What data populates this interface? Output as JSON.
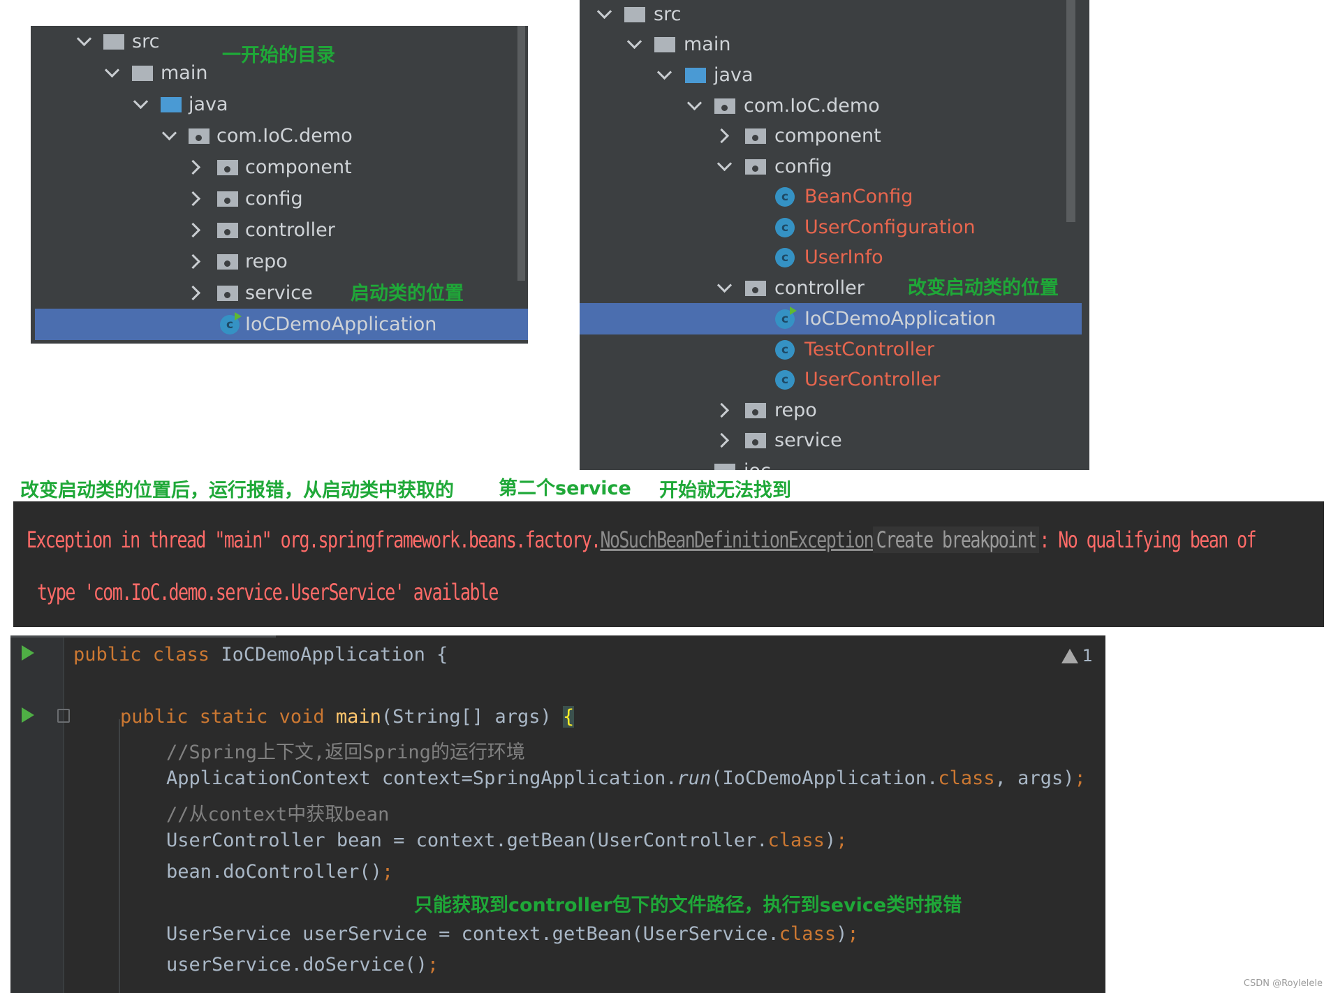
{
  "left_tree": {
    "items": [
      {
        "label": "src",
        "type": "folder"
      },
      {
        "label": "main",
        "type": "folder"
      },
      {
        "label": "java",
        "type": "source-folder"
      },
      {
        "label": "com.IoC.demo",
        "type": "package"
      },
      {
        "label": "component",
        "type": "package"
      },
      {
        "label": "config",
        "type": "package"
      },
      {
        "label": "controller",
        "type": "package"
      },
      {
        "label": "repo",
        "type": "package"
      },
      {
        "label": "service",
        "type": "package"
      },
      {
        "label": "IoCDemoApplication",
        "type": "class",
        "selected": true
      }
    ],
    "note_top": "一开始的目录",
    "note_bottom": "启动类的位置"
  },
  "right_tree": {
    "items": [
      {
        "label": "src",
        "type": "folder"
      },
      {
        "label": "main",
        "type": "folder"
      },
      {
        "label": "java",
        "type": "source-folder"
      },
      {
        "label": "com.IoC.demo",
        "type": "package"
      },
      {
        "label": "component",
        "type": "package"
      },
      {
        "label": "config",
        "type": "package"
      },
      {
        "label": "BeanConfig",
        "type": "class"
      },
      {
        "label": "UserConfiguration",
        "type": "class"
      },
      {
        "label": "UserInfo",
        "type": "class"
      },
      {
        "label": "controller",
        "type": "package"
      },
      {
        "label": "IoCDemoApplication",
        "type": "class",
        "selected": true
      },
      {
        "label": "TestController",
        "type": "class"
      },
      {
        "label": "UserController",
        "type": "class"
      },
      {
        "label": "repo",
        "type": "package"
      },
      {
        "label": "service",
        "type": "package"
      },
      {
        "label": "ioc",
        "type": "package"
      }
    ],
    "note": "改变启动类的位置"
  },
  "caption": {
    "part1": "改变启动类的位置后，运行报错，从启动类中获取的",
    "part2": "第二个service",
    "part3": "开始就无法找到"
  },
  "error": {
    "prefix": "Exception in thread \"main\" org.springframework.beans.factory.",
    "exception": "NoSuchBeanDefinitionException",
    "hint": "Create breakpoint",
    "suffix": ": No qualifying bean of",
    "line2": "type 'com.IoC.demo.service.UserService' available"
  },
  "code": {
    "warning_count": "1",
    "class_kw": "public class ",
    "class_name": "IoCDemoApplication {",
    "main_kw": "public static void ",
    "main_name": "main",
    "main_params": "(String[] args) ",
    "main_brace": "{",
    "comment1": "//Spring上下文,返回Spring的运行环境",
    "ctx_a": "ApplicationContext context=SpringApplication.",
    "ctx_run": "run",
    "ctx_b": "(IoCDemoApplication.",
    "ctx_class": "class",
    "ctx_c": ", args)",
    "ctx_semi": ";",
    "comment2": "//从context中获取bean",
    "bean_a": "UserController bean = context.getBean(UserController.",
    "bean_class": "class",
    "bean_b": ")",
    "bean_semi": ";",
    "doc_a": "bean.doController()",
    "doc_semi": ";",
    "note": "只能获取到controller包下的文件路径，执行到sevice类时报错",
    "svc_a": "UserService userService = context.getBean(UserService.",
    "svc_class": "class",
    "svc_b": ")",
    "svc_semi": ";",
    "dos_a": "userService.doService()",
    "dos_semi": ";"
  },
  "watermark": "CSDN @Roylelele"
}
